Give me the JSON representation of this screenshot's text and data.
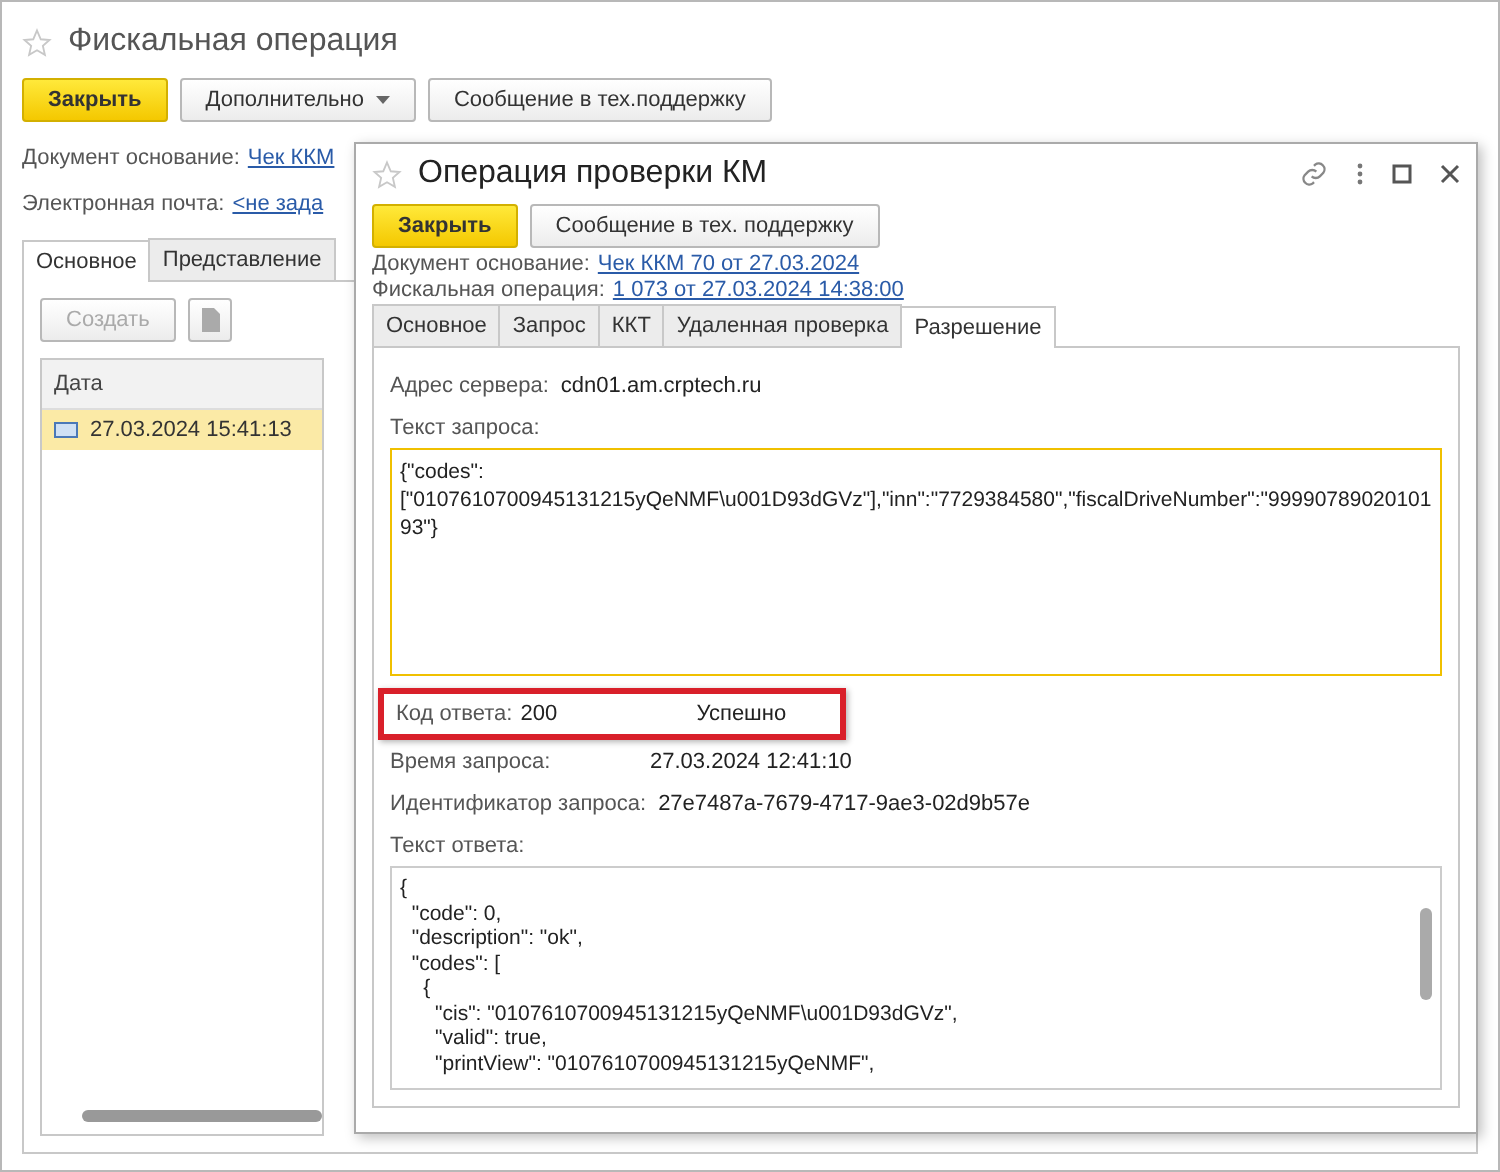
{
  "main_window": {
    "title": "Фискальная операция",
    "buttons": [
      {
        "label": "Закрыть",
        "kind": "primary"
      },
      {
        "label": "Дополнительно",
        "kind": "menu"
      },
      {
        "label": "Сообщение в тех.поддержку",
        "kind": "plain"
      }
    ],
    "fields": [
      {
        "label": "Документ основание:",
        "value": "Чек ККМ"
      },
      {
        "label": "Электронная почта:",
        "value": "<не зада"
      }
    ],
    "tabs": [
      {
        "label": "Основное",
        "selected": true
      },
      {
        "label": "Представление",
        "selected": false
      }
    ],
    "toolbar": {
      "create": {
        "label": "Создать",
        "disabled": true
      }
    },
    "table": {
      "columns": [
        "Дата"
      ],
      "rows": [
        {
          "date": "27.03.2024 15:41:13",
          "selected": true
        }
      ]
    }
  },
  "dialog": {
    "title": "Операция проверки КМ",
    "buttons": [
      {
        "label": "Закрыть",
        "kind": "primary"
      },
      {
        "label": "Сообщение в тех. поддержку",
        "kind": "plain"
      }
    ],
    "fields": [
      {
        "label": "Документ основание:",
        "value": "Чек ККМ 70 от 27.03.2024"
      },
      {
        "label": "Фискальная операция:",
        "value": "1 073 от 27.03.2024 14:38:00"
      }
    ],
    "tabs": [
      {
        "label": "Основное",
        "selected": false
      },
      {
        "label": "Запрос",
        "selected": false
      },
      {
        "label": "ККТ",
        "selected": false
      },
      {
        "label": "Удаленная проверка",
        "selected": false
      },
      {
        "label": "Разрешение",
        "selected": true
      }
    ],
    "server": {
      "label": "Адрес сервера:",
      "value": "cdn01.am.crptech.ru"
    },
    "request_text": {
      "label": "Текст запроса:",
      "lines": [
        "{\"codes\":",
        "[\"0107610700945131215yQeNMF\\u001D93dGVz\"],\"inn\":\"7729384580\",\"fiscalDriveNumber\":\"9999078902010193\"}"
      ]
    },
    "response_code": {
      "label": "Код ответа:",
      "value": "200",
      "status": "Успешно",
      "highlighted": true
    },
    "request_time": {
      "label": "Время запроса:",
      "value": "27.03.2024 12:41:10"
    },
    "request_id": {
      "label": "Идентификатор запроса:",
      "value": "27e7487a-7679-4717-9ae3-02d9b57e"
    },
    "response_text": {
      "label": "Текст ответа:",
      "lines": [
        "{",
        "  \"code\": 0,",
        "  \"description\": \"ok\",",
        "  \"codes\": [",
        "    {",
        "      \"cis\": \"0107610700945131215yQeNMF\\u001D93dGVz\",",
        "      \"valid\": true,",
        "      \"printView\": \"0107610700945131215yQeNMF\","
      ]
    }
  }
}
